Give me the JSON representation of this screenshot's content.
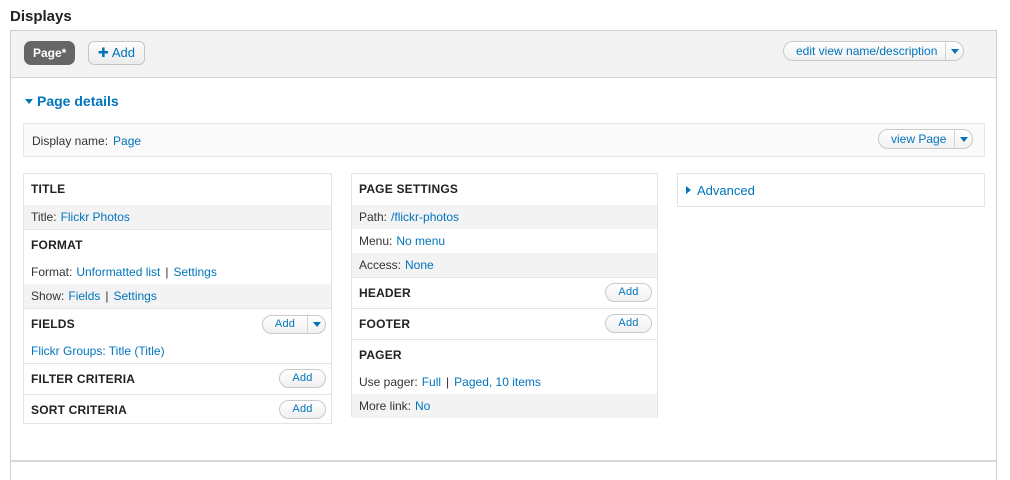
{
  "heading": "Displays",
  "tabs": {
    "active": "Page*",
    "add_label": "Add",
    "add_icon": "plus-icon"
  },
  "edit_view": {
    "label": "edit view name/description"
  },
  "page_details": {
    "toggle": "Page details"
  },
  "display_name": {
    "label": "Display name:",
    "value": "Page"
  },
  "view_page": {
    "label": "view Page"
  },
  "col1": {
    "title": {
      "heading": "TITLE",
      "label": "Title:",
      "value": "Flickr Photos"
    },
    "format": {
      "heading": "FORMAT",
      "format_label": "Format:",
      "format_value": "Unformatted list",
      "format_settings": "Settings",
      "show_label": "Show:",
      "show_value": "Fields",
      "show_settings": "Settings",
      "sep": "|"
    },
    "fields": {
      "heading": "FIELDS",
      "add": "Add",
      "item": "Flickr Groups: Title (Title)"
    },
    "filter": {
      "heading": "FILTER CRITERIA",
      "add": "Add"
    },
    "sort": {
      "heading": "SORT CRITERIA",
      "add": "Add"
    }
  },
  "col2": {
    "page_settings": {
      "heading": "PAGE SETTINGS",
      "path_label": "Path:",
      "path_value": "/flickr-photos",
      "menu_label": "Menu:",
      "menu_value": "No menu",
      "access_label": "Access:",
      "access_value": "None"
    },
    "header": {
      "heading": "HEADER",
      "add": "Add"
    },
    "footer": {
      "heading": "FOOTER",
      "add": "Add"
    },
    "pager": {
      "heading": "PAGER",
      "use_label": "Use pager:",
      "use_value": "Full",
      "use_value2": "Paged, 10 items",
      "more_label": "More link:",
      "more_value": "No",
      "sep": "|"
    }
  },
  "col3": {
    "advanced": "Advanced"
  },
  "colors": {
    "link": "#0074bd",
    "tab_active_bg": "#666666",
    "shade": "#f3f3f3"
  }
}
